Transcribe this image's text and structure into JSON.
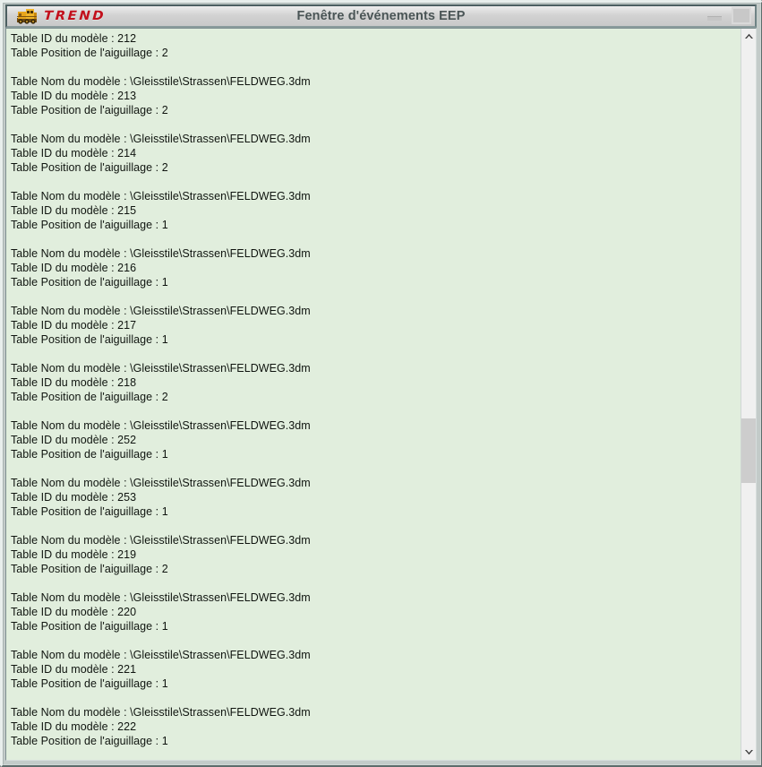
{
  "window": {
    "title": "Fenêtre d'événements EEP",
    "brand": "TREND",
    "logo_icon": "locomotive-icon",
    "buttons": {
      "minimize_label": "Minimize",
      "maximize_label": "Maximize"
    }
  },
  "scrollbar": {
    "up_arrow_icon": "chevron-up-icon",
    "down_arrow_icon": "chevron-down-icon",
    "thumb_top_pct": 53.5,
    "thumb_height_pct": 9.2
  },
  "log": {
    "model_name_label": "Table Nom du modèle :",
    "model_id_label": "Table ID du modèle :",
    "switch_position_label": "Table Position de l'aiguillage :",
    "model_path": "\\Gleisstile\\Strassen\\FELDWEG.3dm",
    "lines": [
      "Table ID du modèle : 212",
      "Table Position de l'aiguillage : 2",
      "",
      "Table Nom du modèle : \\Gleisstile\\Strassen\\FELDWEG.3dm",
      "Table ID du modèle : 213",
      "Table Position de l'aiguillage : 2",
      "",
      "Table Nom du modèle : \\Gleisstile\\Strassen\\FELDWEG.3dm",
      "Table ID du modèle : 214",
      "Table Position de l'aiguillage : 2",
      "",
      "Table Nom du modèle : \\Gleisstile\\Strassen\\FELDWEG.3dm",
      "Table ID du modèle : 215",
      "Table Position de l'aiguillage : 1",
      "",
      "Table Nom du modèle : \\Gleisstile\\Strassen\\FELDWEG.3dm",
      "Table ID du modèle : 216",
      "Table Position de l'aiguillage : 1",
      "",
      "Table Nom du modèle : \\Gleisstile\\Strassen\\FELDWEG.3dm",
      "Table ID du modèle : 217",
      "Table Position de l'aiguillage : 1",
      "",
      "Table Nom du modèle : \\Gleisstile\\Strassen\\FELDWEG.3dm",
      "Table ID du modèle : 218",
      "Table Position de l'aiguillage : 2",
      "",
      "Table Nom du modèle : \\Gleisstile\\Strassen\\FELDWEG.3dm",
      "Table ID du modèle : 252",
      "Table Position de l'aiguillage : 1",
      "",
      "Table Nom du modèle : \\Gleisstile\\Strassen\\FELDWEG.3dm",
      "Table ID du modèle : 253",
      "Table Position de l'aiguillage : 1",
      "",
      "Table Nom du modèle : \\Gleisstile\\Strassen\\FELDWEG.3dm",
      "Table ID du modèle : 219",
      "Table Position de l'aiguillage : 2",
      "",
      "Table Nom du modèle : \\Gleisstile\\Strassen\\FELDWEG.3dm",
      "Table ID du modèle : 220",
      "Table Position de l'aiguillage : 1",
      "",
      "Table Nom du modèle : \\Gleisstile\\Strassen\\FELDWEG.3dm",
      "Table ID du modèle : 221",
      "Table Position de l'aiguillage : 1",
      "",
      "Table Nom du modèle : \\Gleisstile\\Strassen\\FELDWEG.3dm",
      "Table ID du modèle : 222",
      "Table Position de l'aiguillage : 1"
    ]
  },
  "colors": {
    "log_background": "#e1eedd",
    "titlebar": "#d2d2d2",
    "brand_red": "#c2101c",
    "frame": "#b8c2c0",
    "title_text": "#4a5556",
    "scrollbar_track": "#f0f0f0",
    "scrollbar_thumb": "#cdcdcd"
  }
}
